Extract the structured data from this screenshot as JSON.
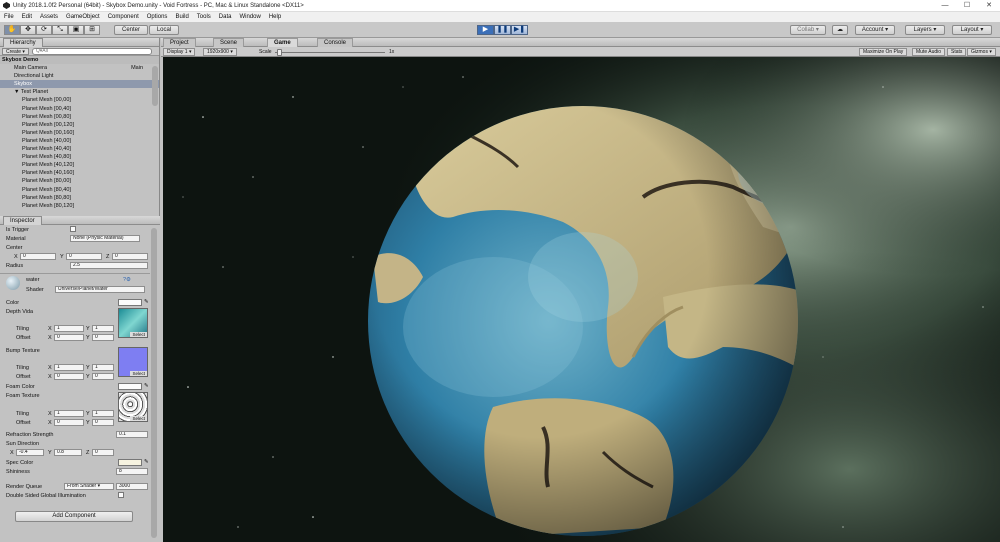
{
  "window": {
    "title": "Unity 2018.1.0f2 Personal (64bit) - Skybox Demo.unity - Void Fortress - PC, Mac & Linux Standalone <DX11>",
    "minimize": "—",
    "maximize": "☐",
    "close": "✕"
  },
  "menu": [
    "File",
    "Edit",
    "Assets",
    "GameObject",
    "Component",
    "Options",
    "Build",
    "Tools",
    "Data",
    "Window",
    "Help"
  ],
  "toolbar": {
    "tools": [
      "✋",
      "✥",
      "⟳",
      "⤡",
      "▣",
      "⊞"
    ],
    "center": "Center",
    "local": "Local",
    "play": "▶",
    "pause": "❚❚",
    "step": "▶❚",
    "collab": "Collab ▾",
    "cloud": "☁",
    "account": "Account ▾",
    "layers": "Layers ▾",
    "layout": "Layout ▾"
  },
  "hierarchy": {
    "tab": "Hierarchy",
    "create": "Create ▾",
    "search_placeholder": "Q▾All",
    "scene": "Skybox Demo",
    "items": [
      {
        "label": "Main Camera",
        "right": "Main",
        "level": 1
      },
      {
        "label": "Directional Light",
        "right": "",
        "level": 1
      },
      {
        "label": "Skybox",
        "right": "",
        "level": 1,
        "selected": true
      },
      {
        "label": "▼ Test Planet",
        "right": "",
        "level": 1
      },
      {
        "label": "Planet Mesh [00,00]",
        "level": 2
      },
      {
        "label": "Planet Mesh [00,40]",
        "level": 2
      },
      {
        "label": "Planet Mesh [00,80]",
        "level": 2
      },
      {
        "label": "Planet Mesh [00,120]",
        "level": 2
      },
      {
        "label": "Planet Mesh [00,160]",
        "level": 2
      },
      {
        "label": "Planet Mesh [40,00]",
        "level": 2
      },
      {
        "label": "Planet Mesh [40,40]",
        "level": 2
      },
      {
        "label": "Planet Mesh [40,80]",
        "level": 2
      },
      {
        "label": "Planet Mesh [40,120]",
        "level": 2
      },
      {
        "label": "Planet Mesh [40,160]",
        "level": 2
      },
      {
        "label": "Planet Mesh [80,00]",
        "level": 2
      },
      {
        "label": "Planet Mesh [80,40]",
        "level": 2
      },
      {
        "label": "Planet Mesh [80,80]",
        "level": 2
      },
      {
        "label": "Planet Mesh [80,120]",
        "level": 2
      }
    ]
  },
  "inspector": {
    "tab": "Inspector",
    "is_trigger": "Is Trigger",
    "material_label": "Material",
    "material_value": "None (Physic Material)",
    "center_label": "Center",
    "cx": "0",
    "cy": "0",
    "cz": "0",
    "radius_label": "Radius",
    "radius_value": "2.5",
    "mat_name": "water",
    "shader_label": "Shader",
    "shader_value": "Universe/Planet/Water",
    "color_label": "Color",
    "depth_label": "Depth Vida",
    "tiling": "Tiling",
    "offset": "Offset",
    "t1x": "1",
    "t1y": "1",
    "o1x": "0",
    "o1y": "0",
    "bump_label": "Bump Texture",
    "t2x": "1",
    "t2y": "1",
    "o2x": "0",
    "o2y": "0",
    "foam_color": "Foam Color",
    "foam_tex": "Foam Texture",
    "t3x": "1",
    "t3y": "1",
    "o3x": "0",
    "o3y": "0",
    "refraction_label": "Refraction Strength",
    "refraction_value": "0.1",
    "sun_label": "Sun Direction",
    "sx": "-0.4",
    "sy": "0.8",
    "sz": "0",
    "spec_label": "Spec Color",
    "shininess_label": "Shininess",
    "shininess_value": "8",
    "rq_label": "Render Queue",
    "rq_mode": "From Shader ▾",
    "rq_value": "3000",
    "dsgi_label": "Double Sided Global Illumination",
    "select": "Select",
    "add_component": "Add Component",
    "x": "X",
    "y": "Y",
    "z": "Z"
  },
  "game": {
    "tabs": [
      "Project",
      "Scene",
      "Game",
      "Console"
    ],
    "display": "Display 1 ▾",
    "resolution": "1920x900 ▾",
    "scale_label": "Scale",
    "scale_value": "1x",
    "maximize": "Maximize On Play",
    "mute": "Mute Audio",
    "stats": "Stats",
    "gizmos": "Gizmos ▾"
  },
  "colors": {
    "ocean": "#2f7fa6",
    "land": "#c8b98a",
    "space": "#0d1410",
    "nebula": "#8ea88f"
  }
}
